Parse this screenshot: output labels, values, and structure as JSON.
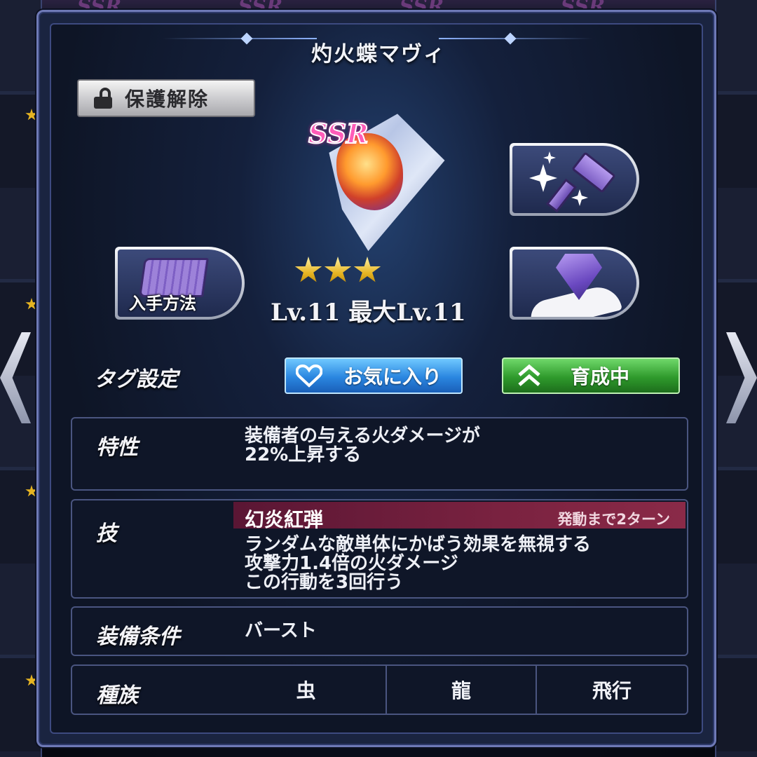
{
  "header": {
    "title": "灼火蝶マヴィ",
    "background_badge": "SSR"
  },
  "protect_button": {
    "label": "保護解除",
    "icon": "unlock-icon"
  },
  "item": {
    "rarity": "SSR",
    "stars": 3,
    "level_text": "Lv.11  最大Lv.11"
  },
  "actions": {
    "source_label": "入手方法",
    "source_icon": "scroll-map-icon",
    "enhance_icon": "hammer-sparkle-icon",
    "limit_break_icon": "gem-hand-icon"
  },
  "tags": {
    "label": "タグ設定",
    "favorite_label": "お気に入り",
    "favorite_icon": "heart-icon",
    "training_label": "育成中",
    "training_icon": "double-chevron-up-icon"
  },
  "trait": {
    "label": "特性",
    "line1": "装備者の与える火ダメージが",
    "line2": "22%上昇する"
  },
  "skill": {
    "label": "技",
    "name": "幻炎紅弾",
    "cooldown": "発動まで2ターン",
    "line1": "ランダムな敵単体にかばう効果を無視する",
    "line2": "攻撃力1.4倍の火ダメージ",
    "line3": "この行動を3回行う"
  },
  "equip": {
    "label": "装備条件",
    "value": "バースト"
  },
  "race": {
    "label": "種族",
    "values": [
      "虫",
      "龍",
      "飛行"
    ]
  },
  "colors": {
    "panel": "#1a2440",
    "favorite": "#2a86e0",
    "training": "#2f9a2c",
    "skill_bar": "#7a2240",
    "star": "#e6b422"
  }
}
